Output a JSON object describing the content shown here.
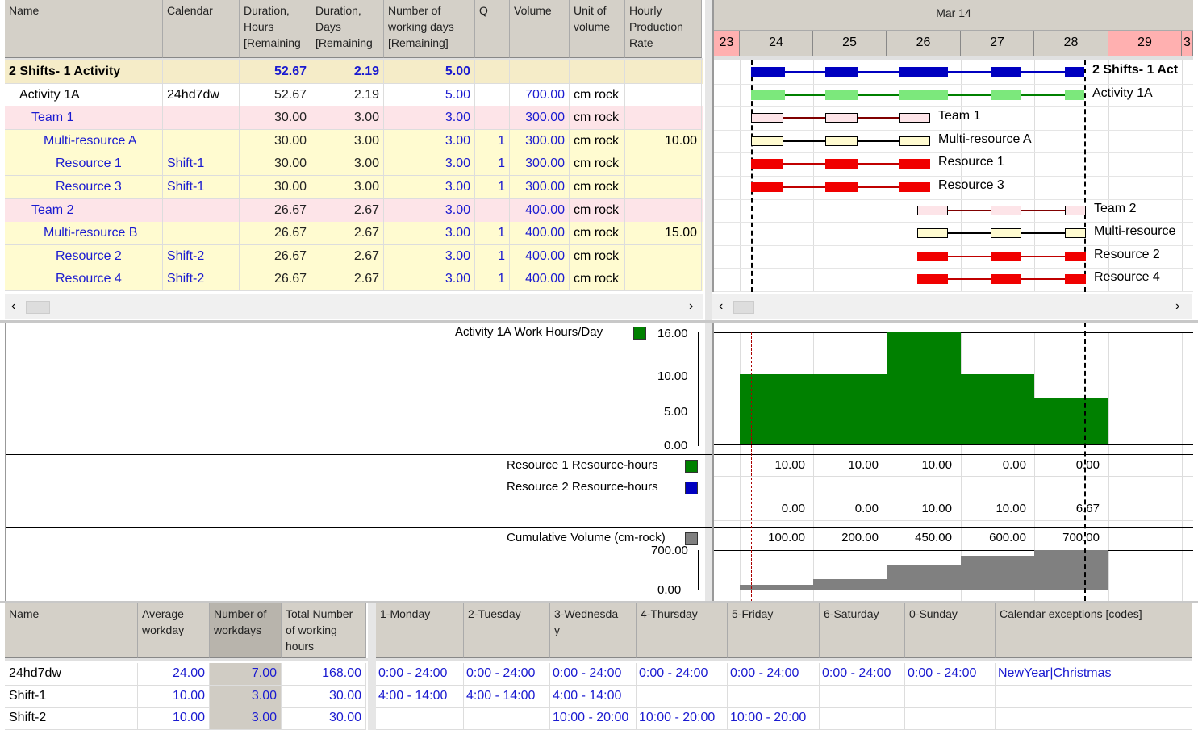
{
  "task_table": {
    "columns": [
      "Name",
      "Calendar",
      "Duration,\nHours\n[Remaining",
      "Duration,\nDays\n[Remaining",
      "Number of\nworking days\n[Remaining]",
      "Q",
      "Volume",
      "Unit of\nvolume",
      "Hourly\nProduction\nRate"
    ],
    "rows": [
      {
        "name": "2 Shifts- 1 Activity",
        "calendar": "",
        "hours": "52.67",
        "days": "2.19",
        "wdays": "5.00",
        "q": "",
        "volume": "",
        "unit": "",
        "rate": ""
      },
      {
        "name": "Activity  1A",
        "calendar": "24hd7dw",
        "hours": "52.67",
        "days": "2.19",
        "wdays": "5.00",
        "q": "",
        "volume": "700.00",
        "unit": "cm rock",
        "rate": ""
      },
      {
        "name": "Team 1",
        "calendar": "",
        "hours": "30.00",
        "days": "3.00",
        "wdays": "3.00",
        "q": "",
        "volume": "300.00",
        "unit": "cm rock",
        "rate": ""
      },
      {
        "name": "Multi-resource A",
        "calendar": "",
        "hours": "30.00",
        "days": "3.00",
        "wdays": "3.00",
        "q": "1",
        "volume": "300.00",
        "unit": "cm rock",
        "rate": "10.00"
      },
      {
        "name": "Resource  1",
        "calendar": "Shift-1",
        "hours": "30.00",
        "days": "3.00",
        "wdays": "3.00",
        "q": "1",
        "volume": "300.00",
        "unit": "cm rock",
        "rate": ""
      },
      {
        "name": "Resource 3",
        "calendar": "Shift-1",
        "hours": "30.00",
        "days": "3.00",
        "wdays": "3.00",
        "q": "1",
        "volume": "300.00",
        "unit": "cm rock",
        "rate": ""
      },
      {
        "name": "Team 2",
        "calendar": "",
        "hours": "26.67",
        "days": "2.67",
        "wdays": "3.00",
        "q": "",
        "volume": "400.00",
        "unit": "cm rock",
        "rate": ""
      },
      {
        "name": "Multi-resource B",
        "calendar": "",
        "hours": "26.67",
        "days": "2.67",
        "wdays": "3.00",
        "q": "1",
        "volume": "400.00",
        "unit": "cm rock",
        "rate": "15.00"
      },
      {
        "name": "Resource  2",
        "calendar": "Shift-2",
        "hours": "26.67",
        "days": "2.67",
        "wdays": "3.00",
        "q": "1",
        "volume": "400.00",
        "unit": "cm rock",
        "rate": ""
      },
      {
        "name": "Resource 4",
        "calendar": "Shift-2",
        "hours": "26.67",
        "days": "2.67",
        "wdays": "3.00",
        "q": "1",
        "volume": "400.00",
        "unit": "cm rock",
        "rate": ""
      }
    ]
  },
  "gantt": {
    "month": "Mar 14",
    "days": [
      "23",
      "24",
      "25",
      "26",
      "27",
      "28",
      "29",
      "3"
    ],
    "bar_labels": [
      "2 Shifts- 1 Act",
      "Activity  1A",
      "Team 1",
      "Multi-resource A",
      "Resource  1",
      "Resource 3",
      "Team 2",
      "Multi-resource",
      "Resource  2",
      "Resource 4"
    ]
  },
  "histogram": {
    "label": "Activity  1A  Work Hours/Day",
    "ticks": [
      "16.00",
      "10.00",
      "5.00",
      "0.00"
    ],
    "values": [
      10,
      10,
      16,
      10,
      6.67
    ]
  },
  "res1": {
    "label": "Resource  1 Resource-hours",
    "values": [
      "10.00",
      "10.00",
      "10.00",
      "0.00",
      "0.00"
    ]
  },
  "res2": {
    "label": "Resource  2 Resource-hours",
    "values": [
      "0.00",
      "0.00",
      "10.00",
      "10.00",
      "6.67"
    ]
  },
  "cumulative": {
    "label": "Cumulative Volume (cm-rock)",
    "ticks": [
      "700.00",
      "0.00"
    ],
    "values": [
      "100.00",
      "200.00",
      "450.00",
      "600.00",
      "700.00"
    ],
    "nums": [
      100,
      200,
      450,
      600,
      700
    ]
  },
  "calendars": {
    "left_columns": [
      "Name",
      "Average\nworkday",
      "Number of\nworkdays",
      "Total Number\nof working\nhours"
    ],
    "right_columns": [
      "1-Monday",
      "2-Tuesday",
      "3-Wednesda\ny",
      "4-Thursday",
      "5-Friday",
      "6-Saturday",
      "0-Sunday",
      "Calendar exceptions [codes]"
    ],
    "rows": [
      {
        "name": "24hd7dw",
        "avg": "24.00",
        "num": "7.00",
        "total": "168.00",
        "days": [
          "0:00 - 24:00",
          "0:00 - 24:00",
          "0:00 - 24:00",
          "0:00 - 24:00",
          "0:00 - 24:00",
          "0:00 - 24:00",
          "0:00 - 24:00",
          "NewYear|Christmas"
        ]
      },
      {
        "name": "Shift-1",
        "avg": "10.00",
        "num": "3.00",
        "total": "30.00",
        "days": [
          " 4:00 - 14:00",
          " 4:00 - 14:00",
          " 4:00 - 14:00",
          "",
          "",
          "",
          "",
          ""
        ]
      },
      {
        "name": "Shift-2",
        "avg": "10.00",
        "num": "3.00",
        "total": "30.00",
        "days": [
          "",
          "",
          "10:00 - 20:00",
          "10:00 - 20:00",
          "10:00 - 20:00",
          "",
          "",
          ""
        ]
      }
    ]
  },
  "colors": {
    "header_bg": "#d4d0c8",
    "summary_bg": "#f5ecc8",
    "team_bg": "#fde4e8",
    "resource_bg": "#fffbd0",
    "blue_bar": "#0000c0",
    "green_bar": "#7ce87c",
    "red_bar": "#f00000",
    "histogram": "#008000",
    "cumulative": "#808080"
  }
}
